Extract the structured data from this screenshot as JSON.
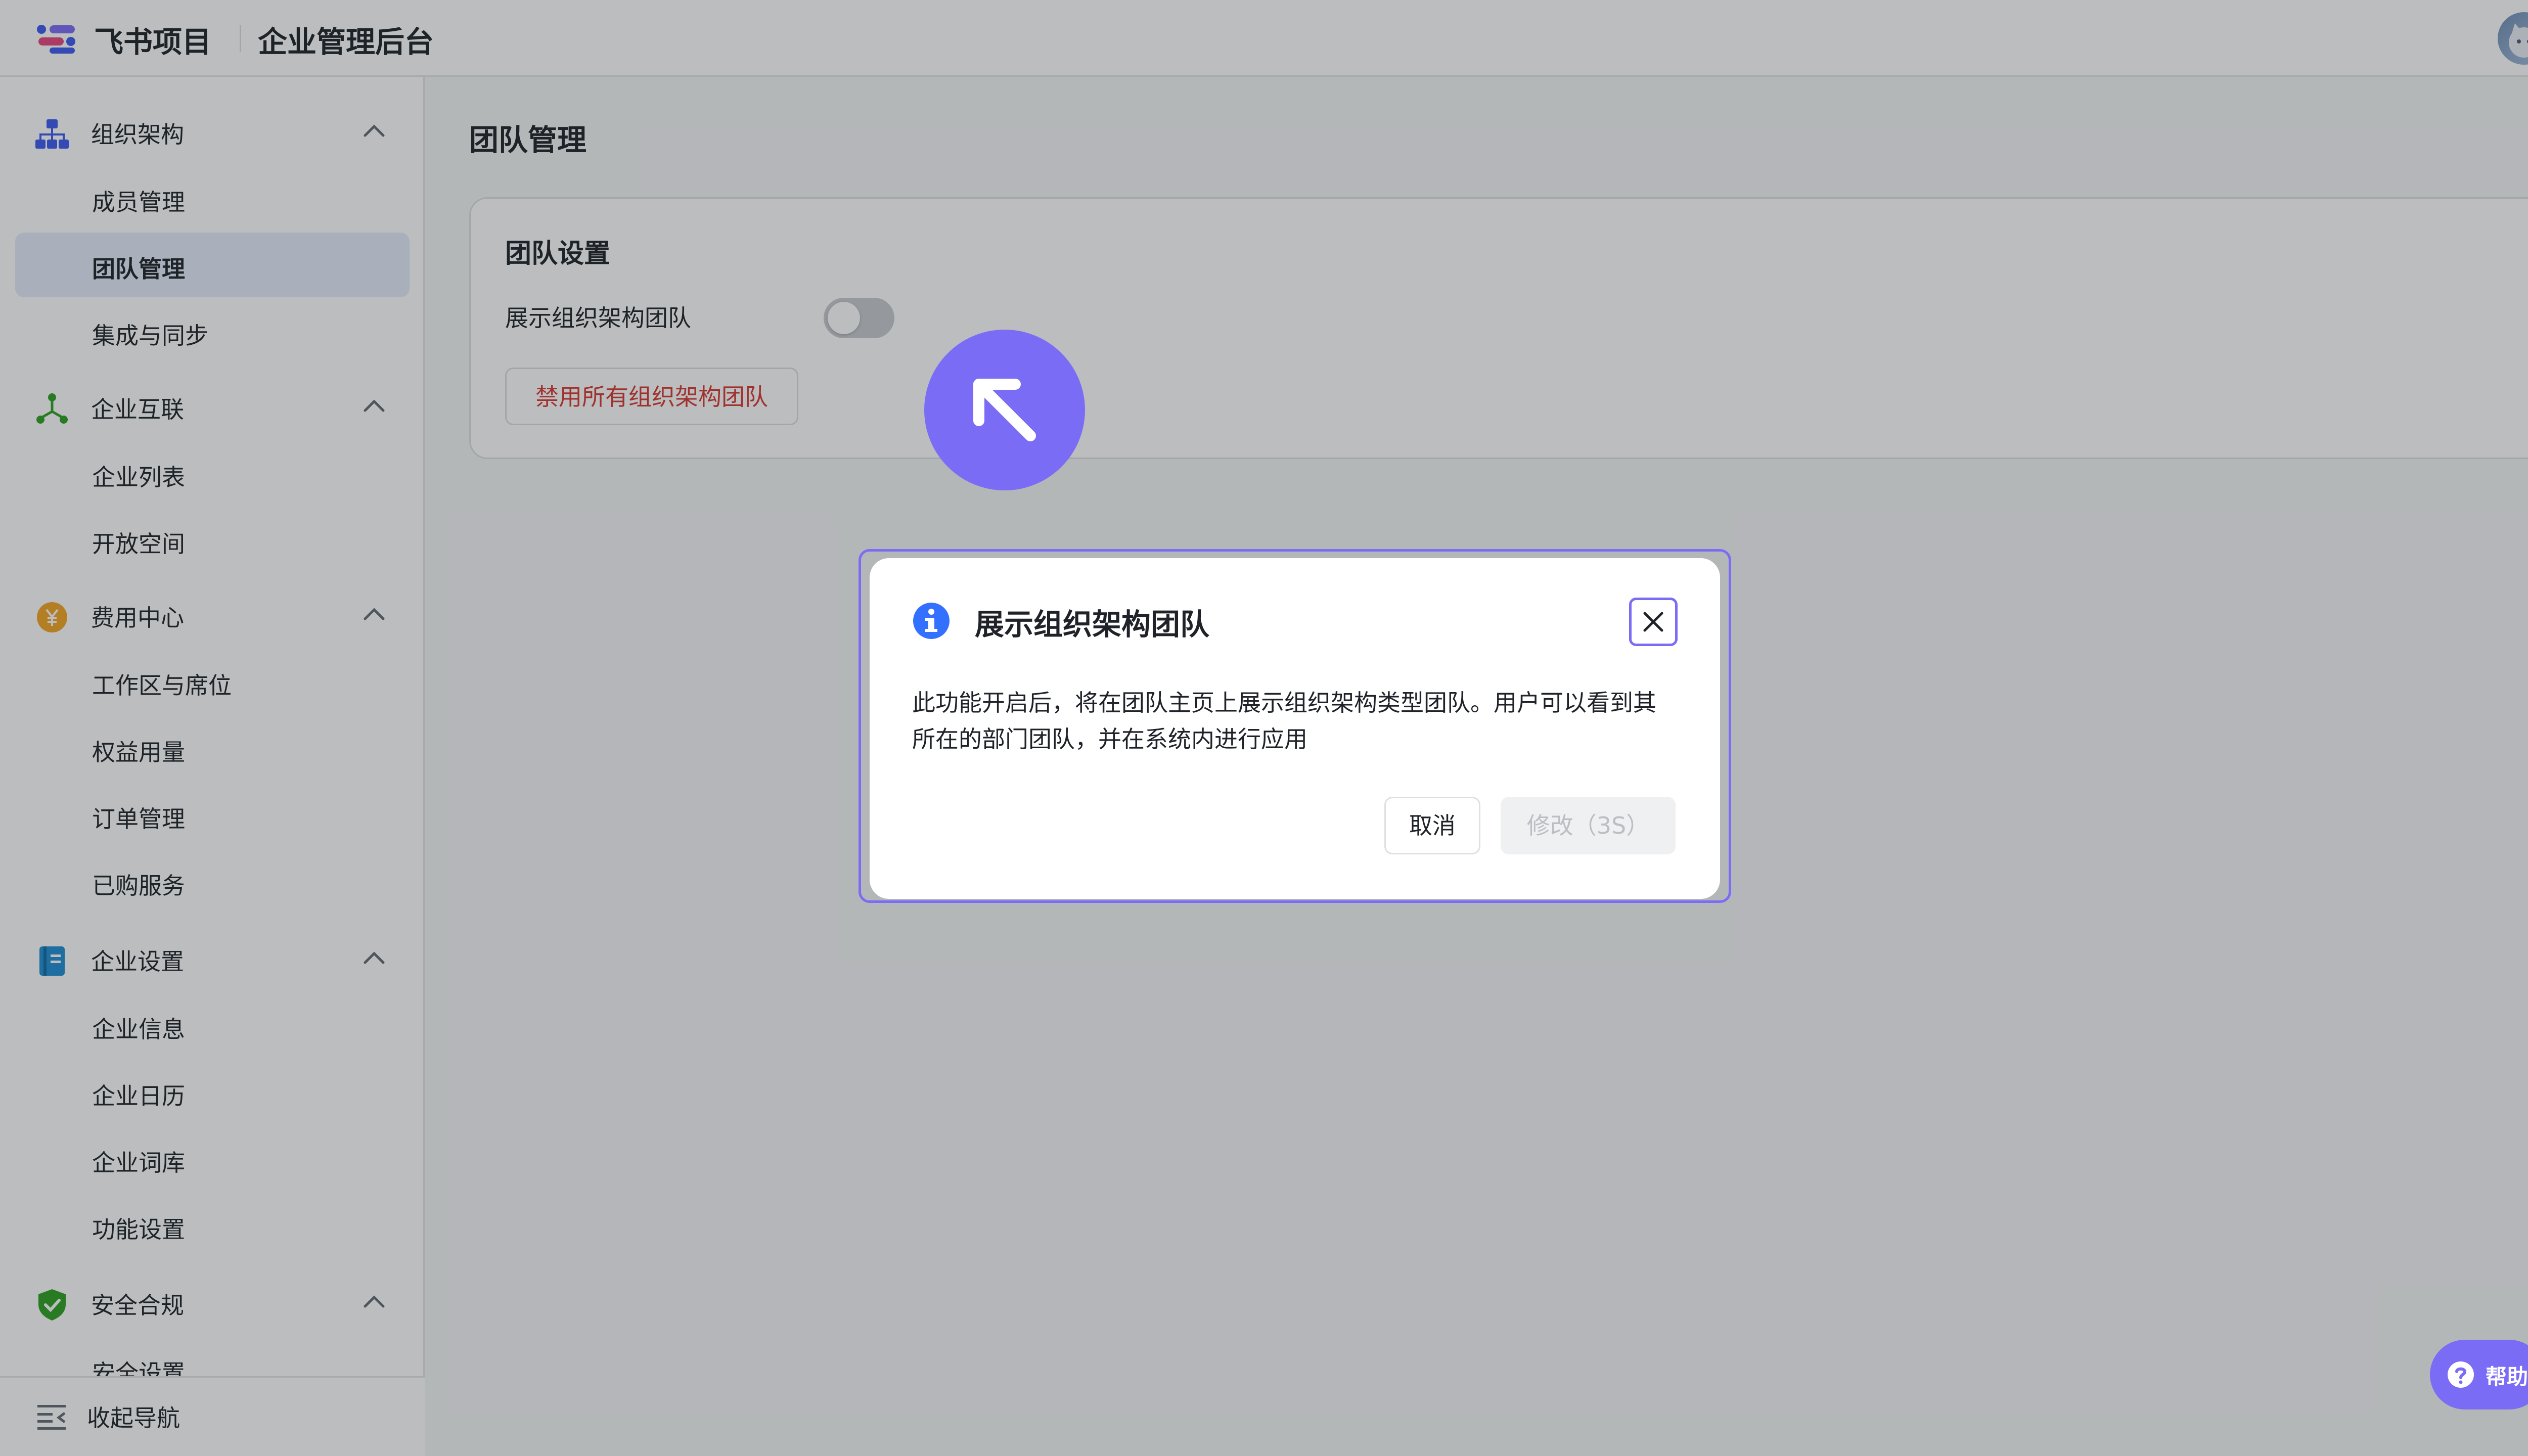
{
  "header": {
    "brand": "飞书项目",
    "console_title": "企业管理后台"
  },
  "sidebar": {
    "groups": [
      {
        "label": "组织架构",
        "icon": "org-chart-icon",
        "items": [
          "成员管理",
          "团队管理",
          "集成与同步"
        ]
      },
      {
        "label": "企业互联",
        "icon": "network-icon",
        "items": [
          "企业列表",
          "开放空间"
        ]
      },
      {
        "label": "费用中心",
        "icon": "yuan-coin-icon",
        "items": [
          "工作区与席位",
          "权益用量",
          "订单管理",
          "已购服务"
        ]
      },
      {
        "label": "企业设置",
        "icon": "notebook-icon",
        "items": [
          "企业信息",
          "企业日历",
          "企业词库",
          "功能设置"
        ]
      },
      {
        "label": "安全合规",
        "icon": "shield-check-icon",
        "items": [
          "安全设置"
        ]
      }
    ],
    "active_item": "团队管理",
    "collapse_label": "收起导航"
  },
  "main": {
    "page_title": "团队管理",
    "card": {
      "title": "团队设置",
      "toggle_label": "展示组织架构团队",
      "toggle_on": false,
      "danger_button": "禁用所有组织架构团队"
    }
  },
  "dialog": {
    "title": "展示组织架构团队",
    "body": "此功能开启后，将在团队主页上展示组织架构类型团队。用户可以看到其所在的部门团队，并在系统内进行应用",
    "cancel_label": "取消",
    "confirm_label": "修改（3S）"
  },
  "help": {
    "label": "帮助"
  },
  "colors": {
    "accent": "#7b6cf6",
    "danger": "#d83931",
    "info": "#3370ff",
    "active_bg": "#e6ecfb"
  }
}
